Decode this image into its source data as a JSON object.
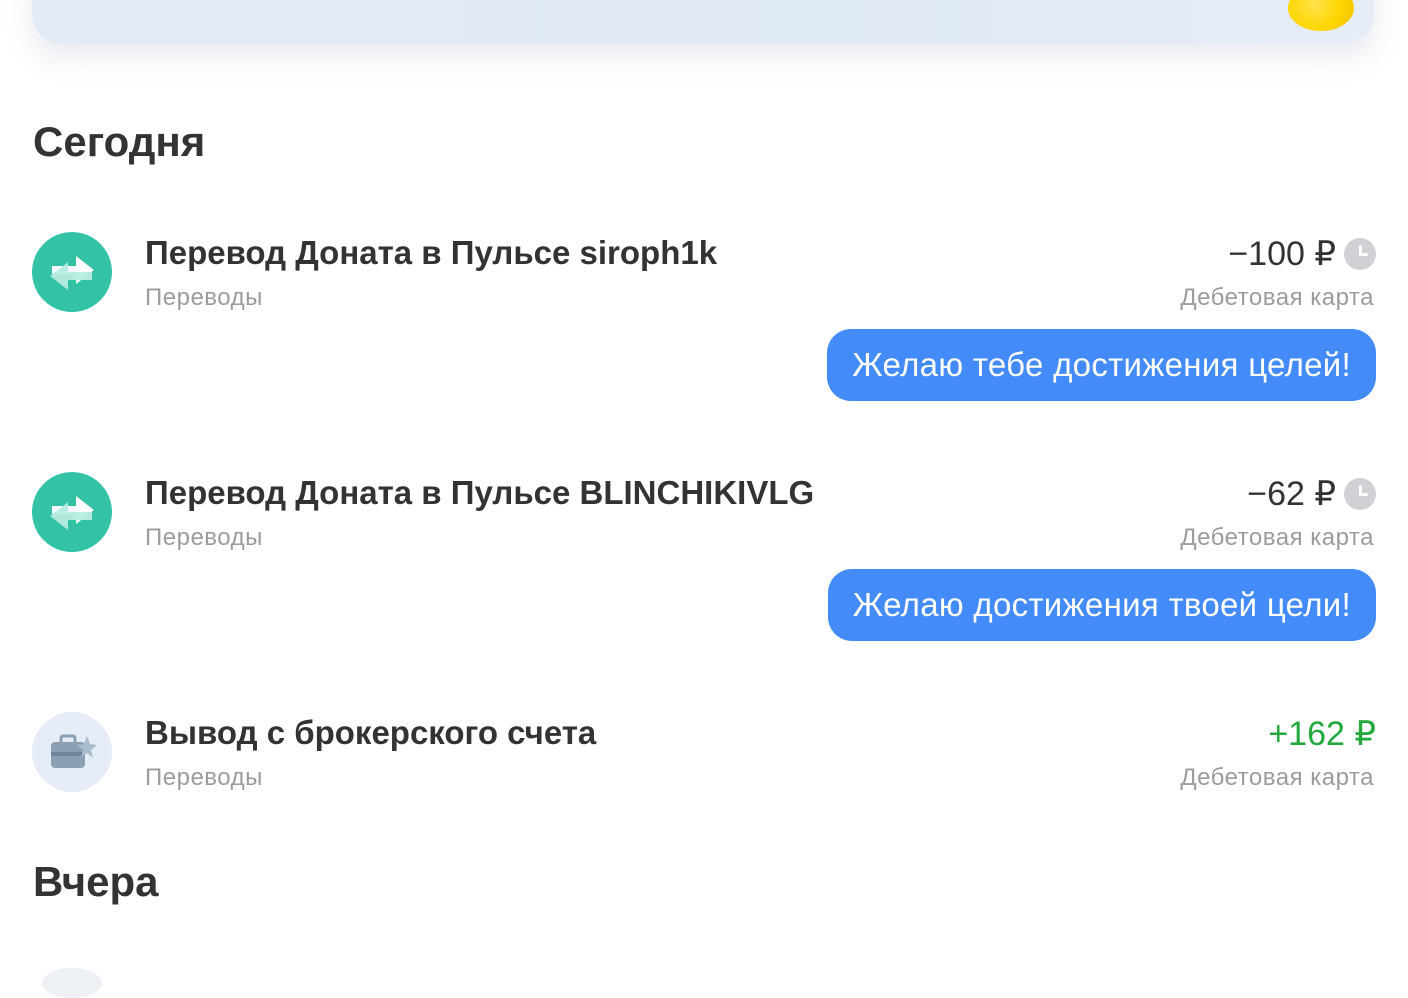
{
  "sections": [
    {
      "title": "Сегодня"
    },
    {
      "title": "Вчера"
    }
  ],
  "transactions": [
    {
      "title": "Перевод Доната в Пульсе siroph1k",
      "category": "Переводы",
      "amount": "−100 ₽",
      "account": "Дебетовая карта",
      "message": "Желаю тебе достижения целей!",
      "icon": "transfer-arrows-icon",
      "icon_bg": "#33c3a4",
      "status_icon": "clock-icon"
    },
    {
      "title": "Перевод Доната в Пульсе BLINCHIKIVLG",
      "category": "Переводы",
      "amount": "−62 ₽",
      "account": "Дебетовая карта",
      "message": "Желаю достижения твоей цели!",
      "icon": "transfer-arrows-icon",
      "icon_bg": "#33c3a4",
      "status_icon": "clock-icon"
    },
    {
      "title": "Вывод с брокерского счета",
      "category": "Переводы",
      "amount": "+162 ₽",
      "account": "Дебетовая карта",
      "icon": "briefcase-icon",
      "icon_bg": "#e6edf6",
      "amount_color": "#22a83d"
    }
  ],
  "colors": {
    "accent_blue": "#428bf9",
    "positive_green": "#22a83d",
    "muted_text": "#9a9ca0",
    "primary_text": "#333333"
  }
}
